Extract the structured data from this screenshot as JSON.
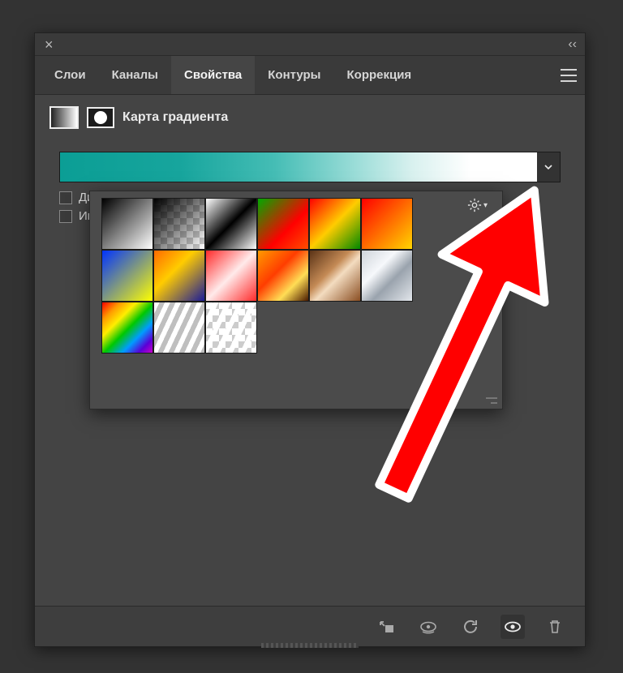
{
  "titlebar": {
    "close": "×",
    "collapse": "‹‹"
  },
  "tabs": [
    "Слои",
    "Каналы",
    "Свойства",
    "Контуры",
    "Коррекция"
  ],
  "active_tab": 2,
  "section": {
    "title": "Карта градиента"
  },
  "gradient": {
    "colors": [
      "#0b9e95",
      "#ffffff"
    ],
    "dropdown_icon": "chevron-down"
  },
  "checkboxes": [
    "Ди",
    "Ин"
  ],
  "preset_picker": {
    "gear_icon": "gear",
    "swatches": [
      {
        "name": "bw-diag",
        "css": "linear-gradient(135deg,#000 0%, #fff 100%)"
      },
      {
        "name": "black-transparent-diag",
        "css": "linear-gradient(135deg,#000 0%, rgba(0,0,0,0) 100%)",
        "checker": true
      },
      {
        "name": "bw-black",
        "css": "linear-gradient(135deg,#fff 0%, #000 50%, #fff 100%)"
      },
      {
        "name": "green-red-diag",
        "css": "linear-gradient(135deg,#0a0 0%, #ff0000 60%, #ff4e00 100%)"
      },
      {
        "name": "red-orange-green",
        "css": "linear-gradient(135deg,#ff0000 0%, #ffcc00 50%, #008800 100%)"
      },
      {
        "name": "red-yellow-diag",
        "css": "linear-gradient(135deg,#ff0000 0%, #ffd500 100%)"
      },
      {
        "name": "blue-yellow-diag",
        "css": "linear-gradient(135deg,#0033ff 0%, #ffff00 100%)"
      },
      {
        "name": "orange-blue-diag",
        "css": "linear-gradient(135deg,#ff6a00 0%, #ffcc00 40%, #1a1a99 100%)"
      },
      {
        "name": "red-white-striped",
        "css": "linear-gradient(135deg,#ff2a2a 0%, #ffeaea 50%, #ff2a2a 100%)"
      },
      {
        "name": "orange-multi",
        "css": "linear-gradient(135deg,#ff9a00 0%, #ff3d00 40%, #ffdd55 70%, #4a1a00 100%)"
      },
      {
        "name": "bronze",
        "css": "linear-gradient(135deg,#5a3316 0%, #c48a55 40%, #f3dcc0 55%, #8a4e22 100%)"
      },
      {
        "name": "silver",
        "css": "linear-gradient(135deg,#cfd4da 0%, #f6f8fb 35%, #9aa3ad 60%, #e2e6eb 100%)"
      },
      {
        "name": "rainbow",
        "css": "linear-gradient(135deg,#ff0000 0%, #ff9a00 18%, #ffee00 34%, #00c800 52%, #009cff 70%, #5a00d6 86%, #c800c8 100%)"
      },
      {
        "name": "white-stripes",
        "css": "repeating-linear-gradient(115deg,#ffffff 0 6px,#bfbfbf 6px 12px)"
      },
      {
        "name": "transparent-stripes",
        "css": "repeating-linear-gradient(115deg,rgba(0,0,0,0) 0 8px, #ffffff 8px 14px)",
        "checker": true
      }
    ]
  },
  "footer_icons": [
    "clip-mask",
    "eye-circle",
    "undo",
    "eye",
    "trash"
  ],
  "active_footer": 3,
  "annotation": {
    "type": "arrow",
    "color": "#ff0000",
    "target": "gradient-dropdown"
  }
}
